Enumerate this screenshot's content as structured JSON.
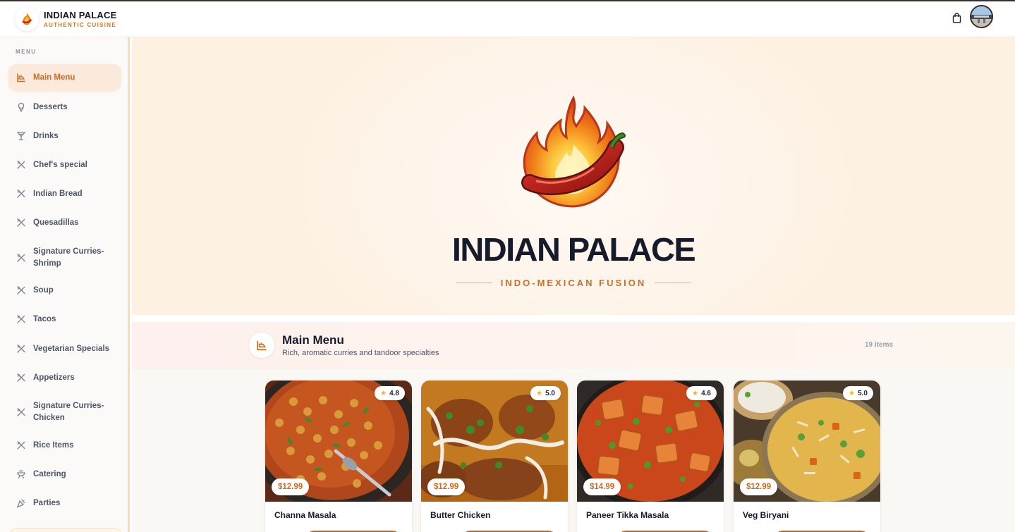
{
  "header": {
    "brand_title": "INDIAN PALACE",
    "brand_subtitle": "AUTHENTIC CUISINE",
    "logo_icon": "flame-logo-icon",
    "cart_icon": "shopping-bag-icon",
    "avatar": "restaurant-photo-avatar"
  },
  "sidebar": {
    "heading": "MENU",
    "items": [
      {
        "label": "Main Menu",
        "icon": "tandoor-icon",
        "active": true
      },
      {
        "label": "Desserts",
        "icon": "ice-cream-icon"
      },
      {
        "label": "Drinks",
        "icon": "cocktail-icon"
      },
      {
        "label": "Chef's special",
        "icon": "utensils-icon"
      },
      {
        "label": "Indian Bread",
        "icon": "utensils-icon"
      },
      {
        "label": "Quesadillas",
        "icon": "utensils-icon"
      },
      {
        "label": "Signature Curries-Shrimp",
        "icon": "utensils-icon"
      },
      {
        "label": "Soup",
        "icon": "utensils-icon"
      },
      {
        "label": "Tacos",
        "icon": "utensils-icon"
      },
      {
        "label": "Vegetarian Specials",
        "icon": "utensils-icon"
      },
      {
        "label": "Appetizers",
        "icon": "utensils-icon"
      },
      {
        "label": "Signature Curries-Chicken",
        "icon": "utensils-icon"
      },
      {
        "label": "Rice Items",
        "icon": "utensils-icon"
      },
      {
        "label": "Catering",
        "icon": "grill-icon"
      },
      {
        "label": "Parties",
        "icon": "party-popper-icon"
      }
    ]
  },
  "hero": {
    "title": "INDIAN PALACE",
    "tagline": "INDO-MEXICAN FUSION",
    "logo_icon": "flame-chili-logo-icon"
  },
  "category": {
    "title": "Main Menu",
    "subtitle": "Rich, aromatic curries and tandoor specialties",
    "count": "19 items",
    "icon": "tandoor-icon"
  },
  "cards": [
    {
      "name": "Channa Masala",
      "price": "$12.99",
      "rating": "4.8",
      "image": "chickpea-curry-photo"
    },
    {
      "name": "Butter Chicken",
      "price": "$12.99",
      "rating": "5.0",
      "image": "butter-chicken-photo"
    },
    {
      "name": "Paneer Tikka Masala",
      "price": "$14.99",
      "rating": "4.6",
      "image": "paneer-tikka-photo"
    },
    {
      "name": "Veg Biryani",
      "price": "$12.99",
      "rating": "5.0",
      "image": "veg-biryani-photo"
    }
  ],
  "colors": {
    "accent": "#d06e22",
    "accent_dark": "#c2661f",
    "title_dark": "#161b2c",
    "active_bg": "#fbeadc",
    "star": "#f5b400"
  }
}
